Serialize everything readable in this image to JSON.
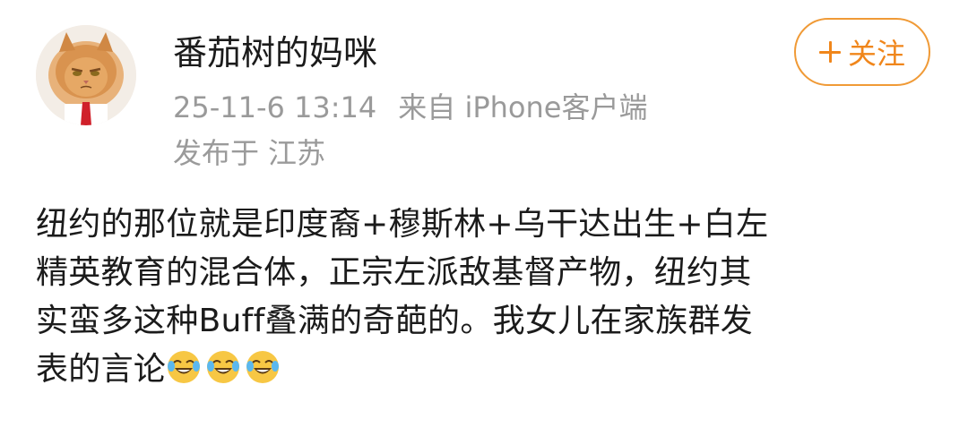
{
  "user": {
    "name": "番茄树的妈咪",
    "timestamp": "25-11-6 13:14",
    "source": "来自 iPhone客户端",
    "location_prefix": "发布于",
    "location": "江苏",
    "avatar_icon": "cat-avatar-icon"
  },
  "actions": {
    "follow_label": "关注",
    "follow_icon": "plus-icon",
    "accent_color": "#f0861b"
  },
  "post": {
    "lines": [
      "纽约的那位就是印度裔+穆斯林+乌干达出生+白左",
      "精英教育的混合体，正宗左派敌基督产物，纽约其",
      "实蛮多这种Buff叠满的奇葩的。我女儿在家族群发",
      "表的言论"
    ],
    "emojis": [
      "laugh-cry-emoji",
      "laugh-cry-emoji",
      "laugh-cry-emoji"
    ]
  }
}
